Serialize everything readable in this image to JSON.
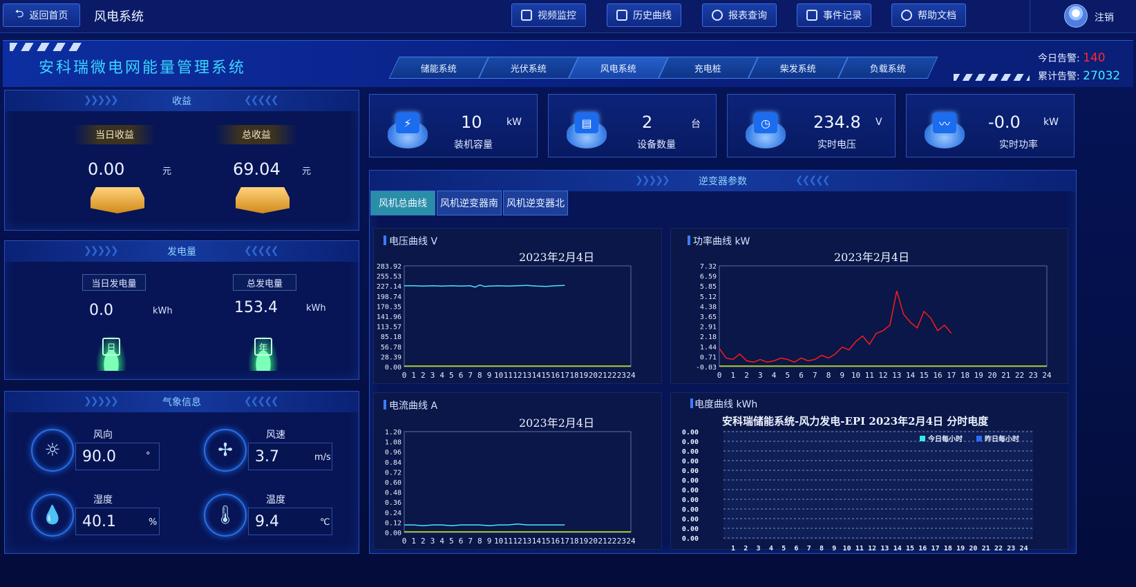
{
  "topbar": {
    "back_label": "返回首页",
    "system_name": "风电系统",
    "buttons": [
      {
        "label": "视频监控",
        "icon": "video-icon"
      },
      {
        "label": "历史曲线",
        "icon": "chart-line-icon"
      },
      {
        "label": "报表查询",
        "icon": "search-icon"
      },
      {
        "label": "事件记录",
        "icon": "document-icon"
      },
      {
        "label": "帮助文档",
        "icon": "help-icon"
      }
    ],
    "logout_label": "注销"
  },
  "header": {
    "title": "安科瑞微电网能量管理系统",
    "tabs": [
      "储能系统",
      "光伏系统",
      "风电系统",
      "充电桩",
      "柴发系统",
      "负载系统"
    ],
    "active_tab": "风电系统",
    "alarm_today_label": "今日告警:",
    "alarm_today_value": "140",
    "alarm_total_label": "累计告警:",
    "alarm_total_value": "27032"
  },
  "income": {
    "title": "收益",
    "today_label": "当日收益",
    "today_value": "0.00",
    "today_unit": "元",
    "total_label": "总收益",
    "total_value": "69.04",
    "total_unit": "元"
  },
  "generation": {
    "title": "发电量",
    "today_label": "当日发电量",
    "today_value": "0.0",
    "today_unit": "kWh",
    "total_label": "总发电量",
    "total_value": "153.4",
    "total_unit": "kWh",
    "today_icon_text": "日",
    "total_icon_text": "年"
  },
  "weather": {
    "title": "气象信息",
    "items": [
      {
        "label": "风向",
        "value": "90.0",
        "unit": "°",
        "icon": "sun-icon"
      },
      {
        "label": "风速",
        "value": "3.7",
        "unit": "m/s",
        "icon": "fan-icon"
      },
      {
        "label": "湿度",
        "value": "40.1",
        "unit": "%",
        "icon": "humidity-icon"
      },
      {
        "label": "温度",
        "value": "9.4",
        "unit": "℃",
        "icon": "thermometer-icon"
      }
    ]
  },
  "stats": [
    {
      "value": "10",
      "unit": "kW",
      "label": "装机容量",
      "icon": "battery-icon"
    },
    {
      "value": "2",
      "unit": "台",
      "label": "设备数量",
      "icon": "device-icon"
    },
    {
      "value": "234.8",
      "unit": "V",
      "label": "实时电压",
      "icon": "gauge-icon"
    },
    {
      "value": "-0.0",
      "unit": "kW",
      "label": "实时功率",
      "icon": "pulse-icon"
    }
  ],
  "inverter": {
    "title": "逆变器参数",
    "tabs": [
      "风机总曲线",
      "风机逆变器南",
      "风机逆变器北"
    ],
    "active_tab": "风机总曲线"
  },
  "colors": {
    "accent": "#39d6ff",
    "alarm_red": "#ff2b2b",
    "alarm_cyan": "#3ff0ff",
    "voltage_line": "#4fe3ff",
    "power_line": "#ff1a1a",
    "baseline": "#c8e000",
    "today_legend": "#38e8e8",
    "yesterday_legend": "#2f6bff"
  },
  "chart_data": [
    {
      "type": "line",
      "panel_title": "电压曲线  V",
      "title": "2023年2月4日",
      "x_ticks": [
        "0",
        "1",
        "2",
        "3",
        "4",
        "5",
        "6",
        "7",
        "8",
        "9",
        "10",
        "11",
        "12",
        "13",
        "14",
        "15",
        "16",
        "17",
        "18",
        "19",
        "20",
        "21",
        "22",
        "23",
        "24"
      ],
      "y_ticks": [
        "283.92",
        "255.53",
        "227.14",
        "198.74",
        "170.35",
        "141.96",
        "113.57",
        "85.18",
        "56.78",
        "28.39",
        "0.00"
      ],
      "xlim": [
        0,
        24
      ],
      "ylim": [
        0,
        283.92
      ],
      "series": [
        {
          "values_x": [
            0,
            1,
            2,
            3,
            4,
            5,
            6,
            7,
            7.5,
            8,
            8.5,
            9,
            10,
            11,
            12,
            13,
            14,
            15,
            16,
            17
          ],
          "values_y": [
            228,
            228,
            227,
            228,
            227,
            228,
            227,
            228,
            224,
            230,
            226,
            227,
            228,
            227,
            228,
            229,
            227,
            226,
            228,
            229
          ]
        }
      ],
      "grid": false
    },
    {
      "type": "line",
      "panel_title": "功率曲线  kW",
      "title": "2023年2月4日",
      "x_ticks": [
        "0",
        "1",
        "2",
        "3",
        "4",
        "5",
        "6",
        "7",
        "8",
        "9",
        "10",
        "11",
        "12",
        "13",
        "14",
        "15",
        "16",
        "17",
        "18",
        "19",
        "20",
        "21",
        "22",
        "23",
        "24"
      ],
      "y_ticks": [
        "7.32",
        "6.59",
        "5.85",
        "5.12",
        "4.38",
        "3.65",
        "2.91",
        "2.18",
        "1.44",
        "0.71",
        "-0.03"
      ],
      "xlim": [
        0,
        24
      ],
      "ylim": [
        -0.03,
        7.32
      ],
      "series": [
        {
          "values_x": [
            0,
            0.5,
            1,
            1.5,
            2,
            2.5,
            3,
            3.5,
            4,
            4.5,
            5,
            5.5,
            6,
            6.5,
            7,
            7.5,
            8,
            8.5,
            9,
            9.5,
            10,
            10.5,
            11,
            11.5,
            12,
            12.5,
            13,
            13.5,
            14,
            14.5,
            15,
            15.5,
            16,
            16.5,
            17
          ],
          "values_y": [
            1.3,
            0.6,
            0.5,
            0.9,
            0.4,
            0.3,
            0.5,
            0.3,
            0.4,
            0.6,
            0.5,
            0.3,
            0.6,
            0.4,
            0.5,
            0.8,
            0.6,
            0.9,
            1.4,
            1.2,
            1.8,
            2.2,
            1.6,
            2.4,
            2.6,
            3.0,
            5.5,
            3.8,
            3.2,
            2.8,
            4.0,
            3.5,
            2.6,
            3.0,
            2.4
          ]
        }
      ],
      "grid": false
    },
    {
      "type": "line",
      "panel_title": "电流曲线  A",
      "title": "2023年2月4日",
      "x_ticks": [
        "0",
        "1",
        "2",
        "3",
        "4",
        "5",
        "6",
        "7",
        "8",
        "9",
        "10",
        "11",
        "12",
        "13",
        "14",
        "15",
        "16",
        "17",
        "18",
        "19",
        "20",
        "21",
        "22",
        "23",
        "24"
      ],
      "y_ticks": [
        "1.20",
        "1.08",
        "0.96",
        "0.84",
        "0.72",
        "0.60",
        "0.48",
        "0.36",
        "0.24",
        "0.12",
        "0.00"
      ],
      "xlim": [
        0,
        24
      ],
      "ylim": [
        0,
        1.2
      ],
      "series": [
        {
          "values_x": [
            0,
            1,
            2,
            3,
            4,
            5,
            6,
            7,
            8,
            9,
            10,
            11,
            12,
            13,
            14,
            15,
            16,
            17
          ],
          "values_y": [
            0.09,
            0.09,
            0.08,
            0.09,
            0.09,
            0.08,
            0.09,
            0.09,
            0.09,
            0.08,
            0.09,
            0.09,
            0.1,
            0.09,
            0.09,
            0.09,
            0.09,
            0.09
          ]
        }
      ],
      "grid": false
    },
    {
      "type": "bar",
      "panel_title": "电度曲线  kWh",
      "title": "安科瑞储能系统-风力发电-EPI 2023年2月4日  分时电度",
      "categories": [
        "1",
        "2",
        "3",
        "4",
        "5",
        "6",
        "7",
        "8",
        "9",
        "10",
        "11",
        "12",
        "13",
        "14",
        "15",
        "16",
        "17",
        "18",
        "19",
        "20",
        "21",
        "22",
        "23",
        "24"
      ],
      "y_ticks": [
        "0.00",
        "0.00",
        "0.00",
        "0.00",
        "0.00",
        "0.00",
        "0.00",
        "0.00",
        "0.00",
        "0.00",
        "0.00",
        "0.00"
      ],
      "series": [
        {
          "name": "今日每小时",
          "values": [
            0,
            0,
            0,
            0,
            0,
            0,
            0,
            0,
            0,
            0,
            0,
            0,
            0,
            0,
            0,
            0,
            0,
            0,
            0,
            0,
            0,
            0,
            0,
            0
          ]
        },
        {
          "name": "昨日每小时",
          "values": [
            0,
            0,
            0,
            0,
            0,
            0,
            0,
            0,
            0,
            0,
            0,
            0,
            0,
            0,
            0,
            0,
            0,
            0,
            0,
            0,
            0,
            0,
            0,
            0
          ]
        }
      ],
      "grid": true,
      "legend": "top-right"
    }
  ]
}
